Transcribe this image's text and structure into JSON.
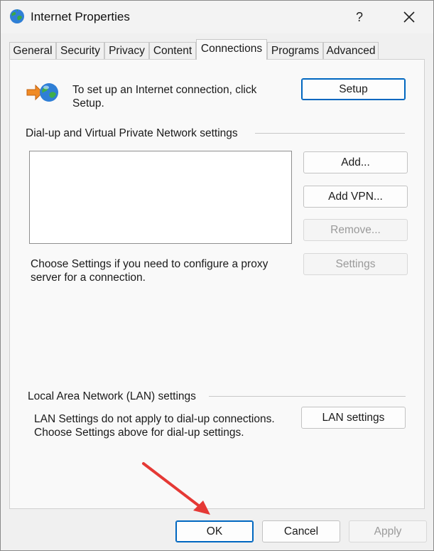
{
  "window": {
    "title": "Internet Properties",
    "help_glyph": "?",
    "icon": "globe-icon",
    "close_icon": "close-icon"
  },
  "tabs": [
    {
      "label": "General"
    },
    {
      "label": "Security"
    },
    {
      "label": "Privacy"
    },
    {
      "label": "Content"
    },
    {
      "label": "Connections",
      "active": true
    },
    {
      "label": "Programs"
    },
    {
      "label": "Advanced"
    }
  ],
  "setup": {
    "text": "To set up an Internet connection, click Setup.",
    "button_label": "Setup",
    "icon": "connection-wizard-icon"
  },
  "dialup": {
    "group_title": "Dial-up and Virtual Private Network settings",
    "add_label": "Add...",
    "add_vpn_label": "Add VPN...",
    "remove_label": "Remove...",
    "settings_label": "Settings",
    "proxy_text": "Choose Settings if you need to configure a proxy server for a connection."
  },
  "lan": {
    "group_title": "Local Area Network (LAN) settings",
    "text": "LAN Settings do not apply to dial-up connections. Choose Settings above for dial-up settings.",
    "button_label": "LAN settings"
  },
  "footer": {
    "ok_label": "OK",
    "cancel_label": "Cancel",
    "apply_label": "Apply"
  },
  "annotation": {
    "icon": "red-arrow-icon",
    "color": "#e53935"
  },
  "colors": {
    "accent": "#0067c0",
    "disabled_text": "#9a9a9a"
  }
}
